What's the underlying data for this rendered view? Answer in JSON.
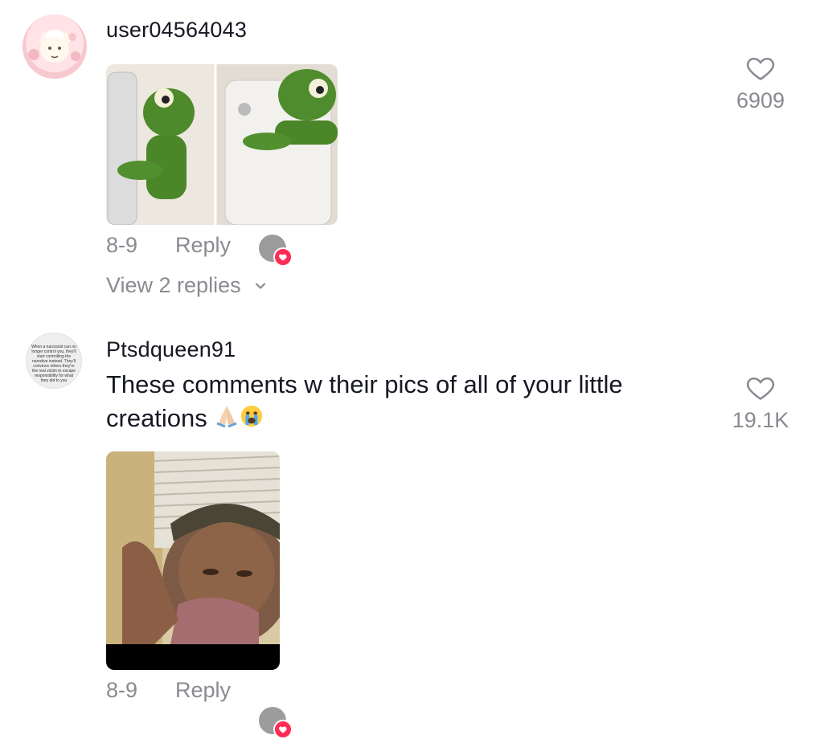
{
  "comments": [
    {
      "username": "user04564043",
      "text": "",
      "date": "8-9",
      "reply_label": "Reply",
      "likes": "6909",
      "view_replies": "View 2 replies"
    },
    {
      "username": "Ptsdqueen91",
      "text": "These comments w their pics of all of your little creations",
      "date": "8-9",
      "reply_label": "Reply",
      "likes": "19.1K",
      "avatar_text": "When a narcissist can no longer control you, they'll start controlling the narrative instead. They'll convince others they're the real victim to escape responsibility for what they did to you"
    }
  ],
  "colors": {
    "like_accent": "#fe2c55",
    "muted": "#8a8b91",
    "text": "#161823"
  },
  "icons": {
    "like": "heart-outline-icon",
    "chevron": "chevron-down-icon",
    "creator_badge": "heart-badge-icon"
  }
}
